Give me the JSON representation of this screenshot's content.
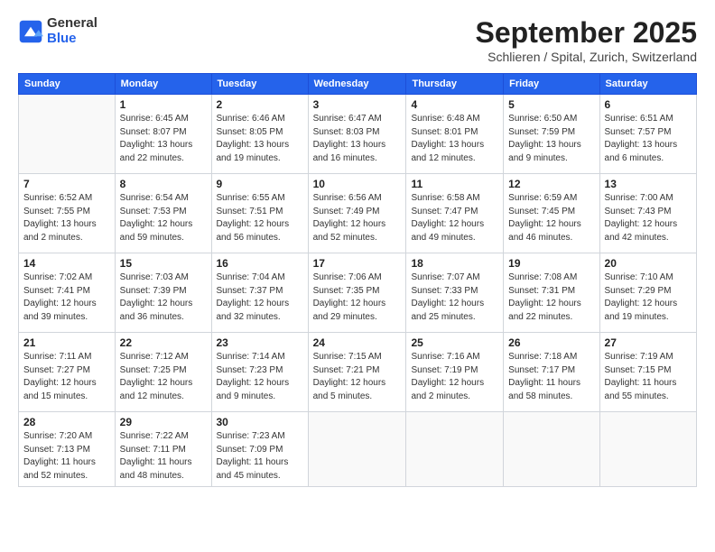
{
  "header": {
    "logo_general": "General",
    "logo_blue": "Blue",
    "month_title": "September 2025",
    "location": "Schlieren / Spital, Zurich, Switzerland"
  },
  "days_of_week": [
    "Sunday",
    "Monday",
    "Tuesday",
    "Wednesday",
    "Thursday",
    "Friday",
    "Saturday"
  ],
  "weeks": [
    [
      {
        "day": "",
        "info": ""
      },
      {
        "day": "1",
        "info": "Sunrise: 6:45 AM\nSunset: 8:07 PM\nDaylight: 13 hours\nand 22 minutes."
      },
      {
        "day": "2",
        "info": "Sunrise: 6:46 AM\nSunset: 8:05 PM\nDaylight: 13 hours\nand 19 minutes."
      },
      {
        "day": "3",
        "info": "Sunrise: 6:47 AM\nSunset: 8:03 PM\nDaylight: 13 hours\nand 16 minutes."
      },
      {
        "day": "4",
        "info": "Sunrise: 6:48 AM\nSunset: 8:01 PM\nDaylight: 13 hours\nand 12 minutes."
      },
      {
        "day": "5",
        "info": "Sunrise: 6:50 AM\nSunset: 7:59 PM\nDaylight: 13 hours\nand 9 minutes."
      },
      {
        "day": "6",
        "info": "Sunrise: 6:51 AM\nSunset: 7:57 PM\nDaylight: 13 hours\nand 6 minutes."
      }
    ],
    [
      {
        "day": "7",
        "info": "Sunrise: 6:52 AM\nSunset: 7:55 PM\nDaylight: 13 hours\nand 2 minutes."
      },
      {
        "day": "8",
        "info": "Sunrise: 6:54 AM\nSunset: 7:53 PM\nDaylight: 12 hours\nand 59 minutes."
      },
      {
        "day": "9",
        "info": "Sunrise: 6:55 AM\nSunset: 7:51 PM\nDaylight: 12 hours\nand 56 minutes."
      },
      {
        "day": "10",
        "info": "Sunrise: 6:56 AM\nSunset: 7:49 PM\nDaylight: 12 hours\nand 52 minutes."
      },
      {
        "day": "11",
        "info": "Sunrise: 6:58 AM\nSunset: 7:47 PM\nDaylight: 12 hours\nand 49 minutes."
      },
      {
        "day": "12",
        "info": "Sunrise: 6:59 AM\nSunset: 7:45 PM\nDaylight: 12 hours\nand 46 minutes."
      },
      {
        "day": "13",
        "info": "Sunrise: 7:00 AM\nSunset: 7:43 PM\nDaylight: 12 hours\nand 42 minutes."
      }
    ],
    [
      {
        "day": "14",
        "info": "Sunrise: 7:02 AM\nSunset: 7:41 PM\nDaylight: 12 hours\nand 39 minutes."
      },
      {
        "day": "15",
        "info": "Sunrise: 7:03 AM\nSunset: 7:39 PM\nDaylight: 12 hours\nand 36 minutes."
      },
      {
        "day": "16",
        "info": "Sunrise: 7:04 AM\nSunset: 7:37 PM\nDaylight: 12 hours\nand 32 minutes."
      },
      {
        "day": "17",
        "info": "Sunrise: 7:06 AM\nSunset: 7:35 PM\nDaylight: 12 hours\nand 29 minutes."
      },
      {
        "day": "18",
        "info": "Sunrise: 7:07 AM\nSunset: 7:33 PM\nDaylight: 12 hours\nand 25 minutes."
      },
      {
        "day": "19",
        "info": "Sunrise: 7:08 AM\nSunset: 7:31 PM\nDaylight: 12 hours\nand 22 minutes."
      },
      {
        "day": "20",
        "info": "Sunrise: 7:10 AM\nSunset: 7:29 PM\nDaylight: 12 hours\nand 19 minutes."
      }
    ],
    [
      {
        "day": "21",
        "info": "Sunrise: 7:11 AM\nSunset: 7:27 PM\nDaylight: 12 hours\nand 15 minutes."
      },
      {
        "day": "22",
        "info": "Sunrise: 7:12 AM\nSunset: 7:25 PM\nDaylight: 12 hours\nand 12 minutes."
      },
      {
        "day": "23",
        "info": "Sunrise: 7:14 AM\nSunset: 7:23 PM\nDaylight: 12 hours\nand 9 minutes."
      },
      {
        "day": "24",
        "info": "Sunrise: 7:15 AM\nSunset: 7:21 PM\nDaylight: 12 hours\nand 5 minutes."
      },
      {
        "day": "25",
        "info": "Sunrise: 7:16 AM\nSunset: 7:19 PM\nDaylight: 12 hours\nand 2 minutes."
      },
      {
        "day": "26",
        "info": "Sunrise: 7:18 AM\nSunset: 7:17 PM\nDaylight: 11 hours\nand 58 minutes."
      },
      {
        "day": "27",
        "info": "Sunrise: 7:19 AM\nSunset: 7:15 PM\nDaylight: 11 hours\nand 55 minutes."
      }
    ],
    [
      {
        "day": "28",
        "info": "Sunrise: 7:20 AM\nSunset: 7:13 PM\nDaylight: 11 hours\nand 52 minutes."
      },
      {
        "day": "29",
        "info": "Sunrise: 7:22 AM\nSunset: 7:11 PM\nDaylight: 11 hours\nand 48 minutes."
      },
      {
        "day": "30",
        "info": "Sunrise: 7:23 AM\nSunset: 7:09 PM\nDaylight: 11 hours\nand 45 minutes."
      },
      {
        "day": "",
        "info": ""
      },
      {
        "day": "",
        "info": ""
      },
      {
        "day": "",
        "info": ""
      },
      {
        "day": "",
        "info": ""
      }
    ]
  ]
}
